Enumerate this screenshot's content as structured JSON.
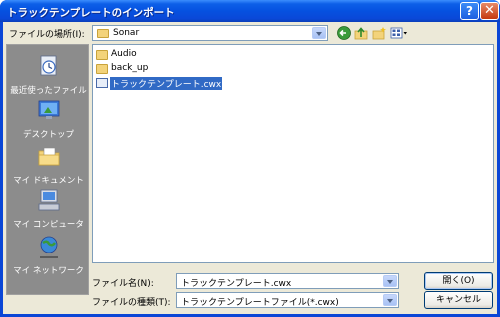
{
  "window": {
    "title": "トラックテンプレートのインポート",
    "help_glyph": "?",
    "close_glyph": "✕"
  },
  "location": {
    "label": "ファイルの場所(I):",
    "value": "Sonar"
  },
  "toolbar": {
    "icons": [
      "back-icon",
      "up-folder-icon",
      "new-folder-icon",
      "view-menu-icon"
    ]
  },
  "places": [
    {
      "label": "最近使ったファイル",
      "icon": "recent-files-icon"
    },
    {
      "label": "デスクトップ",
      "icon": "desktop-icon"
    },
    {
      "label": "マイ ドキュメント",
      "icon": "my-documents-icon"
    },
    {
      "label": "マイ コンピュータ",
      "icon": "my-computer-icon"
    },
    {
      "label": "マイ ネットワーク",
      "icon": "my-network-icon"
    }
  ],
  "files": [
    {
      "name": "Audio",
      "type": "folder",
      "selected": false
    },
    {
      "name": "back_up",
      "type": "folder",
      "selected": false
    },
    {
      "name": "トラックテンプレート.cwx",
      "type": "cwx",
      "selected": true
    }
  ],
  "filename": {
    "label": "ファイル名(N):",
    "value": "トラックテンプレート.cwx"
  },
  "filetype": {
    "label": "ファイルの種類(T):",
    "value": "トラックテンプレートファイル(*.cwx)"
  },
  "buttons": {
    "open": "開く(O)",
    "cancel": "キャンセル"
  },
  "colors": {
    "title_bar": "#0651e0",
    "dialog_bg": "#ece9d8",
    "places_bar": "#8c8c8c",
    "selection": "#316ac5"
  }
}
